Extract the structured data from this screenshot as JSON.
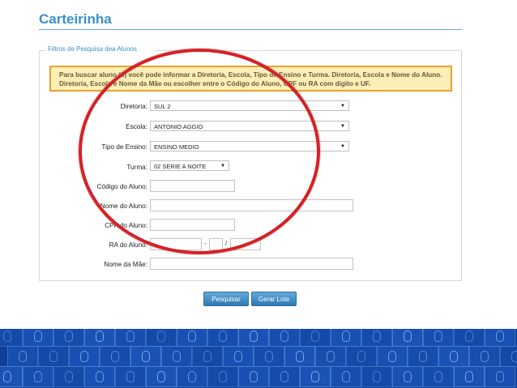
{
  "page": {
    "title": "Carteirinha"
  },
  "filters": {
    "legend": "Filtros de Pesquisa dea Alunos",
    "notice": "Para buscar aluno (s) você pode informar a Diretoria, Escola, Tipo de Ensino e Turma. Diretoria, Escola e Nome do Aluno. Diretoria, Escola e Nome da Mãe ou escolher entre o Código do Aluno, CPF ou RA com digito e UF.",
    "labels": {
      "diretoria": "Diretoria:",
      "escola": "Escola:",
      "tipo_ensino": "Tipo de Ensino:",
      "turma": "Turma:",
      "codigo_aluno": "Código do Aluno:",
      "nome_aluno": "Nome do Aluno:",
      "cpf_aluno": "CPF do Aluno:",
      "ra_aluno": "RA do Aluno:",
      "nome_mae": "Nome da Mãe:"
    },
    "values": {
      "diretoria": "SUL 2",
      "escola": "ANTONIO AGGIO",
      "tipo_ensino": "ENSINO MEDIO",
      "turma": "02 SERIE A NOITE"
    },
    "ra_separators": {
      "dash": "-",
      "slash": "/"
    }
  },
  "actions": {
    "search_label": "Pesquisar",
    "batch_label": "Gerar Lote"
  },
  "colors": {
    "accent": "#3a8fc4",
    "highlight_circle": "#d42128",
    "notice_border": "#e6a22f",
    "notice_bg": "#fbeeb7",
    "footer": "#0f3f9a"
  },
  "icons": {
    "dropdown": "chevron-down-icon",
    "footer_pattern": "computer-mouse-icon"
  }
}
